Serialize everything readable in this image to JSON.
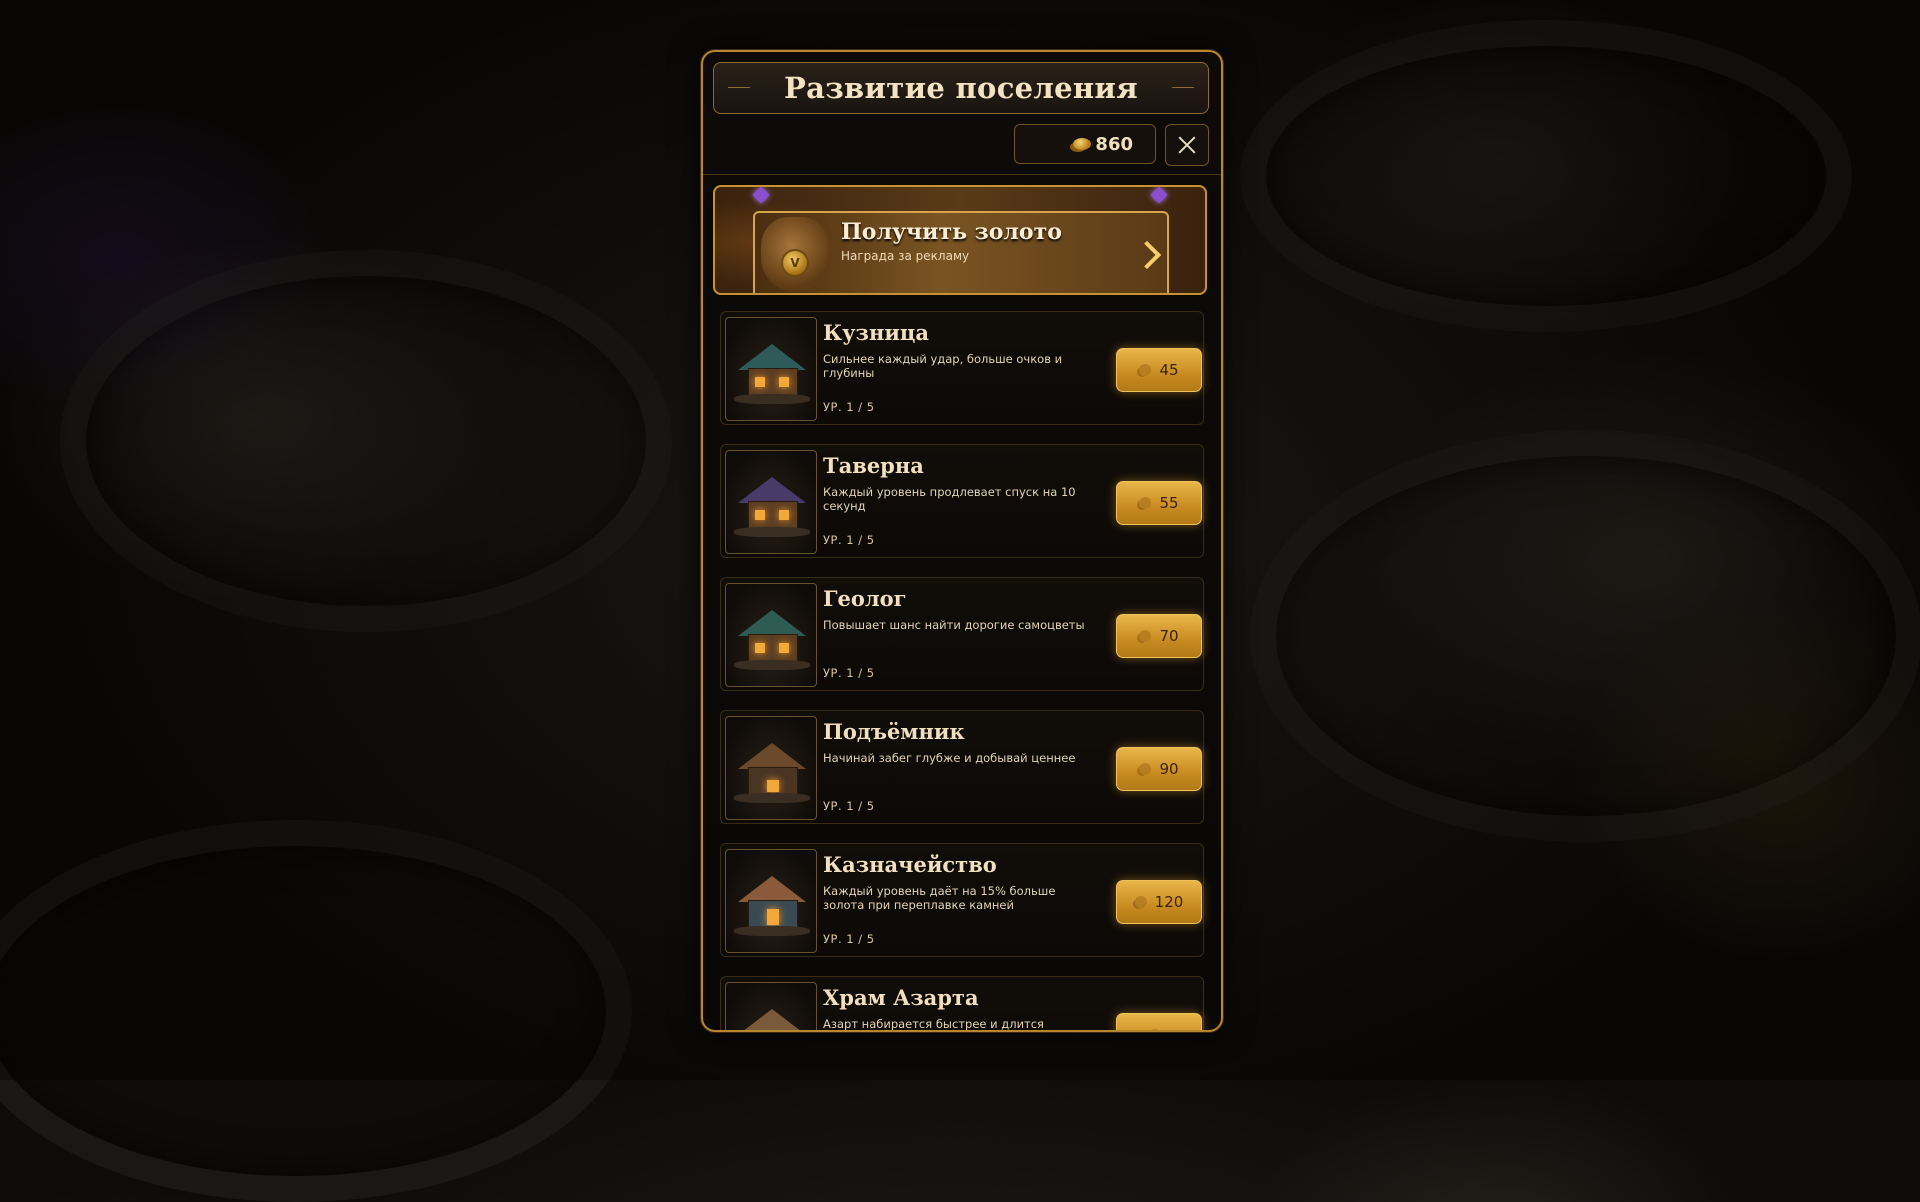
{
  "header": {
    "title": "Развитие поселения"
  },
  "currency": {
    "gold_icon": "gold-coins-icon",
    "gold_amount": "860"
  },
  "close_icon": "close-icon",
  "ad_offer": {
    "title": "Получить золото",
    "subtitle": "Награда за рекламу",
    "icon": "gold-bag-icon",
    "arrow_icon": "chevron-right-icon"
  },
  "buildings": [
    {
      "name": "Кузница",
      "description": "Сильнее каждый удар, больше очков и глубины",
      "level": "УР. 1 / 5",
      "cost": "45",
      "thumb_icon": "forge-icon"
    },
    {
      "name": "Таверна",
      "description": "Каждый уровень продлевает спуск на 10 секунд",
      "level": "УР. 1 / 5",
      "cost": "55",
      "thumb_icon": "tavern-icon"
    },
    {
      "name": "Геолог",
      "description": "Повышает шанс найти дорогие самоцветы",
      "level": "УР. 1 / 5",
      "cost": "70",
      "thumb_icon": "geologist-icon"
    },
    {
      "name": "Подъёмник",
      "description": "Начинай забег глубже и добывай ценнее",
      "level": "УР. 1 / 5",
      "cost": "90",
      "thumb_icon": "lift-icon"
    },
    {
      "name": "Казначейство",
      "description": "Каждый уровень даёт на 15% больше золота при переплавке камней",
      "level": "УР. 1 / 5",
      "cost": "120",
      "thumb_icon": "treasury-icon"
    },
    {
      "name": "Храм Азарта",
      "description": "Азарт набирается быстрее и длится дольше",
      "level": "",
      "cost": "",
      "thumb_icon": "temple-icon"
    }
  ],
  "colors": {
    "accent_gold": "#c89233",
    "button_gold": "#e9b64a",
    "panel_bg": "#0d0a08",
    "text_light": "#f1dfbd"
  }
}
